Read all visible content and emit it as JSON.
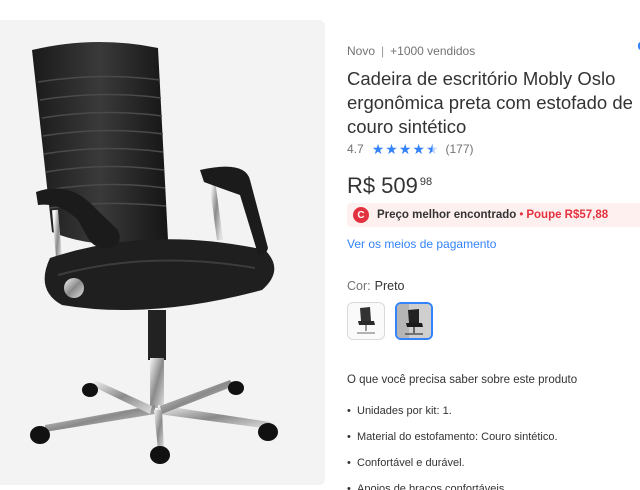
{
  "product": {
    "condition": "Novo",
    "sold": "+1000 vendidos",
    "title": "Cadeira de escritório Mobly Oslo ergonômica preta com estofado de couro sintético",
    "rating": "4.7",
    "rating_value": 4.7,
    "reviews": "(177)",
    "price": {
      "currency": "R$",
      "integer": "509",
      "cents": "98"
    },
    "best_price": {
      "label": "Preço melhor encontrado",
      "saving": "Poupe R$57,88"
    },
    "payment_link": "Ver os meios de pagamento",
    "color": {
      "label": "Cor:",
      "value": "Preto"
    },
    "must_know_title": "O que você precisa saber sobre este produto",
    "features": [
      "Unidades por kit: 1.",
      "Material do estofamento: Couro sintético.",
      "Confortável e durável.",
      "Apoios de braços confortáveis."
    ]
  },
  "icons": {
    "star": "star-icon",
    "best_price": "price-tag-icon"
  },
  "colors": {
    "accent": "#3483fa",
    "discount": "#e3323f",
    "badge_bg": "#fff0f0",
    "panel_bg": "#f3f3f3"
  }
}
